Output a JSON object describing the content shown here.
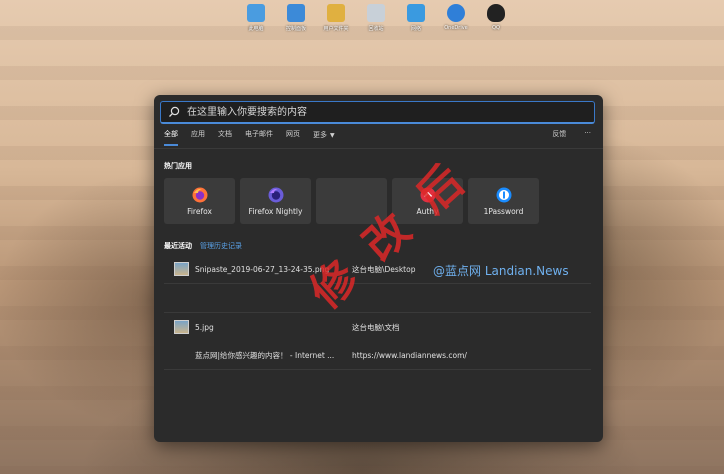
{
  "desktop": {
    "icons": [
      {
        "label": "此电脑",
        "icon": "computer-icon",
        "color": "#4a9ce0"
      },
      {
        "label": "控制面板",
        "icon": "control-panel-icon",
        "color": "#3c8ad8"
      },
      {
        "label": "用户文件夹",
        "icon": "user-folder-icon",
        "color": "#e0b040"
      },
      {
        "label": "回收站",
        "icon": "recycle-bin-icon",
        "color": "#c8d0d8"
      },
      {
        "label": "网络",
        "icon": "network-icon",
        "color": "#3a9ae0"
      },
      {
        "label": "OneDrive",
        "icon": "onedrive-icon",
        "color": "#2f7fd8"
      },
      {
        "label": "QQ",
        "icon": "qq-penguin-icon",
        "color": "#222222"
      }
    ]
  },
  "search": {
    "placeholder": "在这里输入你要搜索的内容"
  },
  "tabs": [
    {
      "label": "全部",
      "active": true
    },
    {
      "label": "应用"
    },
    {
      "label": "文档"
    },
    {
      "label": "电子邮件"
    },
    {
      "label": "网页"
    },
    {
      "label": "更多"
    }
  ],
  "tabs_right": {
    "feedback": "反馈",
    "more": "···"
  },
  "top_apps": {
    "title": "热门应用",
    "items": [
      {
        "name": "Firefox",
        "icon": "firefox-icon",
        "color": "#ff7139"
      },
      {
        "name": "Firefox Nightly",
        "icon": "firefox-nightly-icon",
        "color": "#6a5cd8"
      },
      {
        "name": "",
        "icon": "",
        "color": "#3b3b3b"
      },
      {
        "name": "Authy",
        "icon": "authy-icon",
        "color": "#e03040"
      },
      {
        "name": "1Password",
        "icon": "1password-icon",
        "color": "#1a8cff"
      }
    ]
  },
  "recent": {
    "title": "最近活动",
    "manage": "管理历史记录",
    "rows": [
      {
        "name": "Snipaste_2019-06-27_13-24-35.png",
        "location": "这台电脑\\Desktop"
      },
      {
        "name": "5.jpg",
        "location": "这台电脑\\文档"
      },
      {
        "name": "蓝点网|给你感兴趣的内容！ - Internet ...",
        "location": "https://www.landiannews.com/"
      }
    ]
  },
  "watermark": "@蓝点网 Landian.News",
  "stamp": "修 改 后"
}
